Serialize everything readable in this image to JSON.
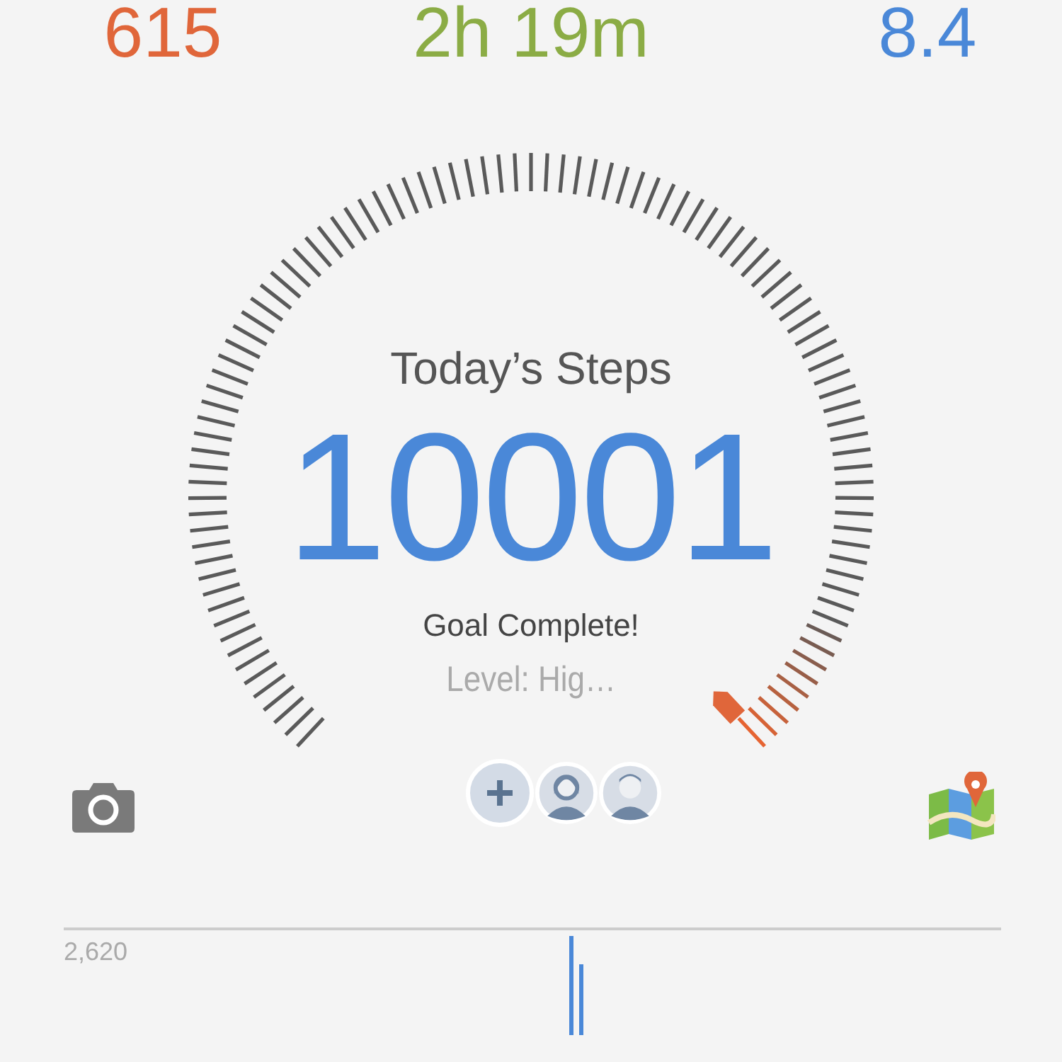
{
  "stats": [
    {
      "value": "615",
      "color": "#e0663a"
    },
    {
      "value": "2h 19m",
      "color": "#8bac45"
    },
    {
      "value": "8.4",
      "color": "#4a88d8"
    }
  ],
  "gauge": {
    "title": "Today’s Steps",
    "steps": "10001",
    "status": "Goal Complete!",
    "level_text": "Level: Hig…"
  },
  "chart": {
    "max_label": "2,620"
  }
}
